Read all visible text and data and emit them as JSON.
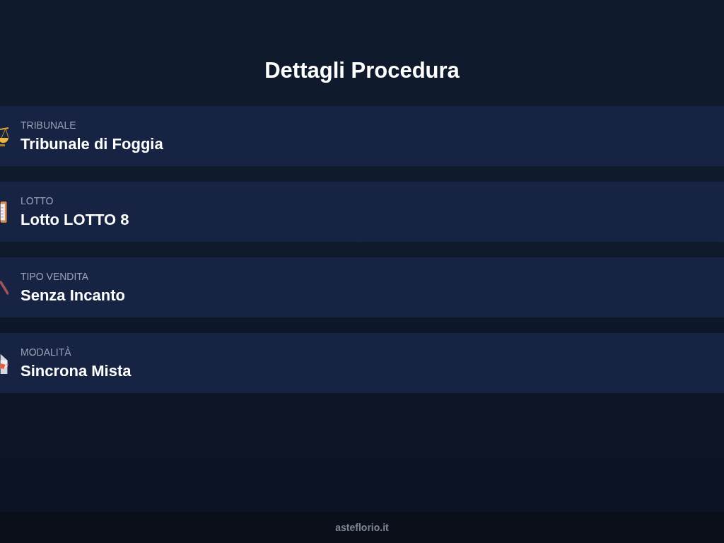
{
  "header": {
    "title": "Dettagli Procedura"
  },
  "details": [
    {
      "kind": "scales",
      "label": "TRIBUNALE",
      "value": "Tribunale di Foggia"
    },
    {
      "kind": "clipboard",
      "label": "LOTTO",
      "value": "Lotto LOTTO 8"
    },
    {
      "kind": "gavel",
      "label": "TIPO VENDITA",
      "value": "Senza Incanto"
    },
    {
      "kind": "envelope",
      "label": "MODALITÀ",
      "value": "Sincrona Mista"
    }
  ],
  "footer": {
    "text": "asteflorio.it"
  }
}
